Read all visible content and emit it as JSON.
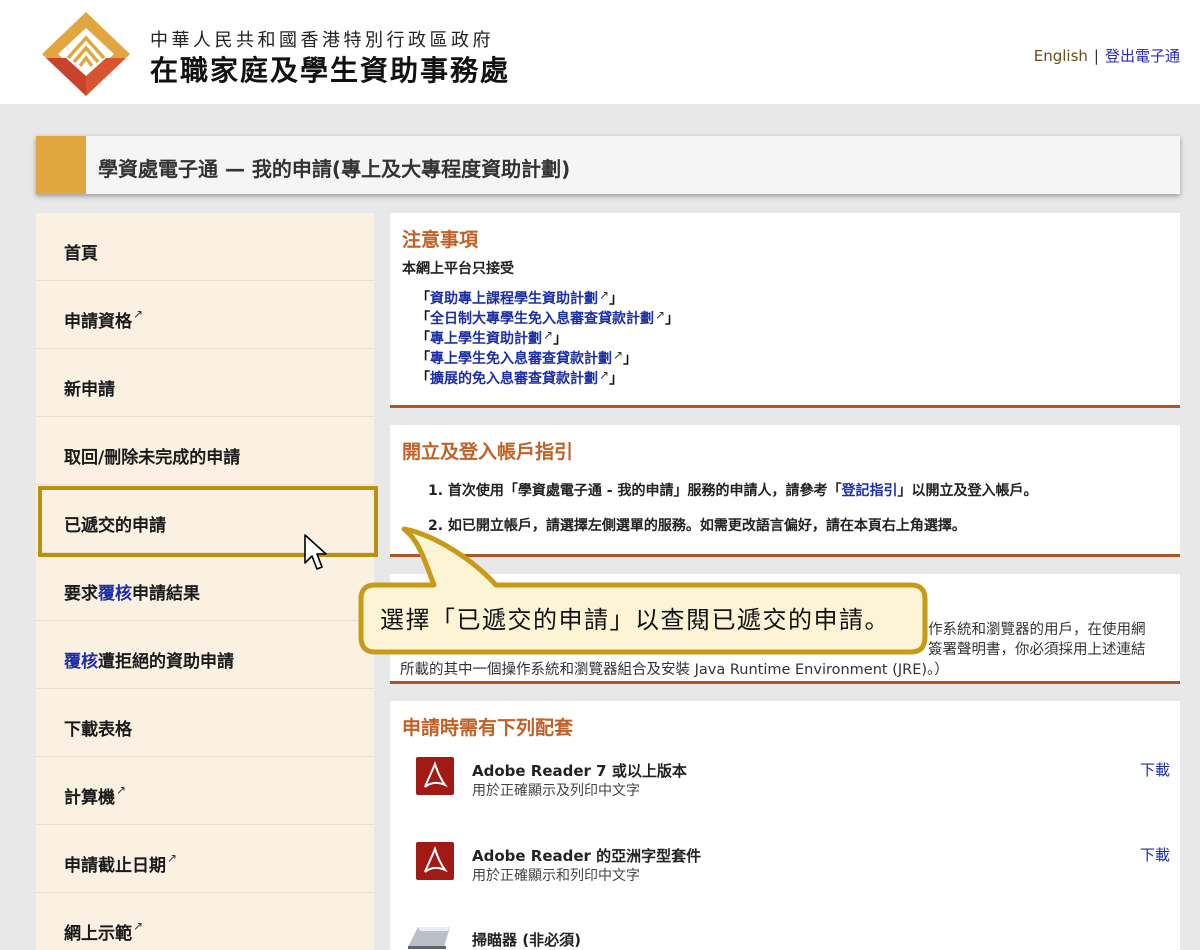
{
  "header": {
    "org_line1": "中華人民共和國香港特別行政區政府",
    "org_line2": "在職家庭及學生資助事務處",
    "lang_english": "English",
    "lang_separator": "|",
    "logout": "登出電子通"
  },
  "page_title": "學資處電子通 — 我的申請(專上及大專程度資助計劃)",
  "sidebar": {
    "items": [
      {
        "label": "首頁"
      },
      {
        "label": "申請資格"
      },
      {
        "label": "新申請"
      },
      {
        "label": "取回/刪除未完成的申請"
      },
      {
        "label": "已遞交的申請"
      },
      {
        "label_pre": "要求",
        "label_hl": "覆核",
        "label_post": "申請結果"
      },
      {
        "label_hl": "覆核",
        "label_post": "遭拒絕的資助申請"
      },
      {
        "label": "下載表格"
      },
      {
        "label": "計算機"
      },
      {
        "label": "申請截止日期"
      },
      {
        "label": "網上示範"
      }
    ],
    "external_icon": "↗",
    "selected_index": 4
  },
  "notice": {
    "title": "注意事項",
    "intro": "本網上平台只接受",
    "links": [
      "資助專上課程學生資助計劃",
      "全日制大專學生免入息審查貸款計劃",
      "專上學生資助計劃",
      "專上學生免入息審查貸款計劃",
      "擴展的免入息審查貸款計劃"
    ],
    "open_bracket": "「",
    "close_bracket": "」"
  },
  "guide": {
    "title": "開立及登入帳戶指引",
    "step1_pre": "1. 首次使用「學資處電子通 - 我的申請」服務的申請人，請參考「",
    "step1_link": "登記指引",
    "step1_post": "」以開立及登入帳戶。",
    "step2": "2. 如已開立帳戶，請選擇左側選單的服務。如需更改語言偏好，請在本頁右上角選擇。"
  },
  "system": {
    "line1_visible": "作系統和瀏覽器的用戶，在使用網",
    "line2_visible": "簽署聲明書，你必須採用上述連結",
    "line3": "所載的其中一個操作系統和瀏覽器組合及安裝 Java Runtime Environment (JRE)。）"
  },
  "requirements": {
    "title": "申請時需有下列配套",
    "items": [
      {
        "name": "Adobe Reader 7 或以上版本",
        "desc": "用於正確顯示及列印中文字",
        "download": "下載",
        "icon": "pdf-icon"
      },
      {
        "name": "Adobe Reader 的亞洲字型套件",
        "desc": "用於正確顯示和列印中文字",
        "download": "下載",
        "icon": "pdf-icon"
      },
      {
        "name": "掃瞄器 (非必須)",
        "icon": "scanner-icon"
      }
    ]
  },
  "callout": {
    "text": "選擇「已遞交的申請」以查閱已遞交的申請。"
  },
  "colors": {
    "accent_gold": "#e2a640",
    "highlight_border": "#b9910e",
    "section_title": "#c06127",
    "link_blue": "#1d2fa6",
    "sidebar_bg": "#fbf1e3",
    "pdf_red": "#a11a16"
  }
}
